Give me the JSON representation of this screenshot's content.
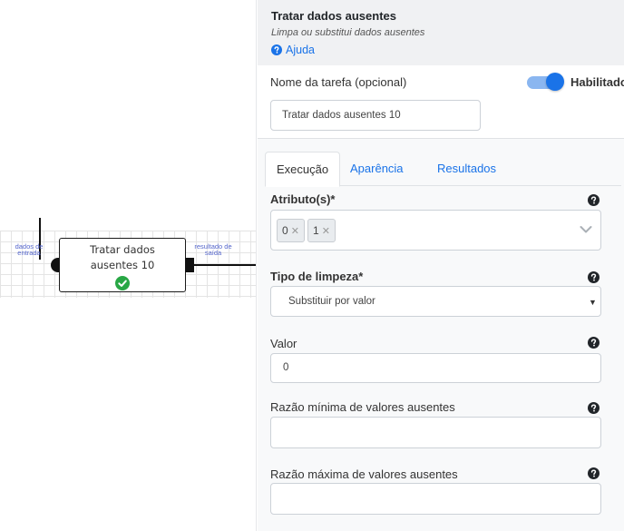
{
  "canvas": {
    "node": {
      "title": "Tratar dados\nausentes 10",
      "status": "check-circle-icon",
      "input_port_label": "dados de entrada",
      "output_port_label": "resultado de saída"
    }
  },
  "panel": {
    "title": "Tratar dados ausentes",
    "subtitle": "Limpa ou substitui dados ausentes",
    "help_link": "Ajuda",
    "task_name": {
      "label": "Nome da tarefa (opcional)",
      "value": "Tratar dados ausentes 10"
    },
    "enabled_toggle": {
      "label": "Habilitado",
      "on": true
    },
    "tabs": [
      {
        "label": "Execução",
        "active": true
      },
      {
        "label": "Aparência",
        "active": false
      },
      {
        "label": "Resultados",
        "active": false
      }
    ],
    "fields": {
      "attributes": {
        "label": "Atributo(s)*",
        "chips": [
          "0",
          "1"
        ]
      },
      "cleaning_type": {
        "label": "Tipo de limpeza*",
        "value": "Substituir por valor"
      },
      "value": {
        "label": "Valor",
        "value": "0"
      },
      "min_ratio": {
        "label": "Razão mínima de valores ausentes",
        "value": ""
      },
      "max_ratio": {
        "label": "Razão máxima de valores ausentes",
        "value": ""
      }
    }
  },
  "colors": {
    "accent": "#1a73e8",
    "success": "#28a745",
    "panel_header_bg": "#f0f1f3"
  }
}
